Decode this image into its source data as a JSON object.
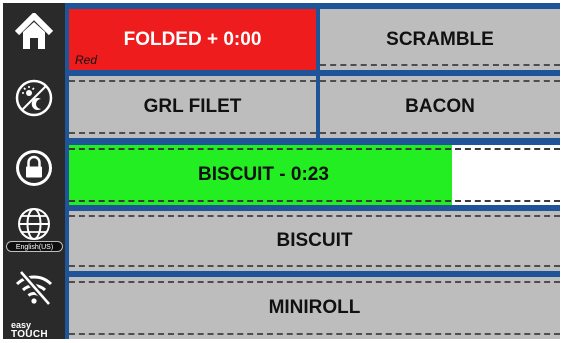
{
  "sidebar": {
    "home_icon": "home-icon",
    "day_night_icon": "day-night-icon",
    "lock_icon": "lock-icon",
    "language_icon": "globe-icon",
    "language_label": "English(US)",
    "wifi_icon": "wifi-off-icon",
    "brand_line1": "easy",
    "brand_line2": "TOUCH"
  },
  "buttons": {
    "folded": {
      "label": "FOLDED + 0:00",
      "corner_label": "Red",
      "color": "#ee1c1c"
    },
    "scramble": {
      "label": "SCRAMBLE"
    },
    "grl_filet": {
      "label": "GRL FILET"
    },
    "bacon": {
      "label": "BACON"
    },
    "biscuit_timer": {
      "label": "BISCUIT - 0:23",
      "progress_percent": 78,
      "color": "#22ee22"
    },
    "biscuit": {
      "label": "BISCUIT"
    },
    "miniroll": {
      "label": "MINIROLL"
    }
  }
}
